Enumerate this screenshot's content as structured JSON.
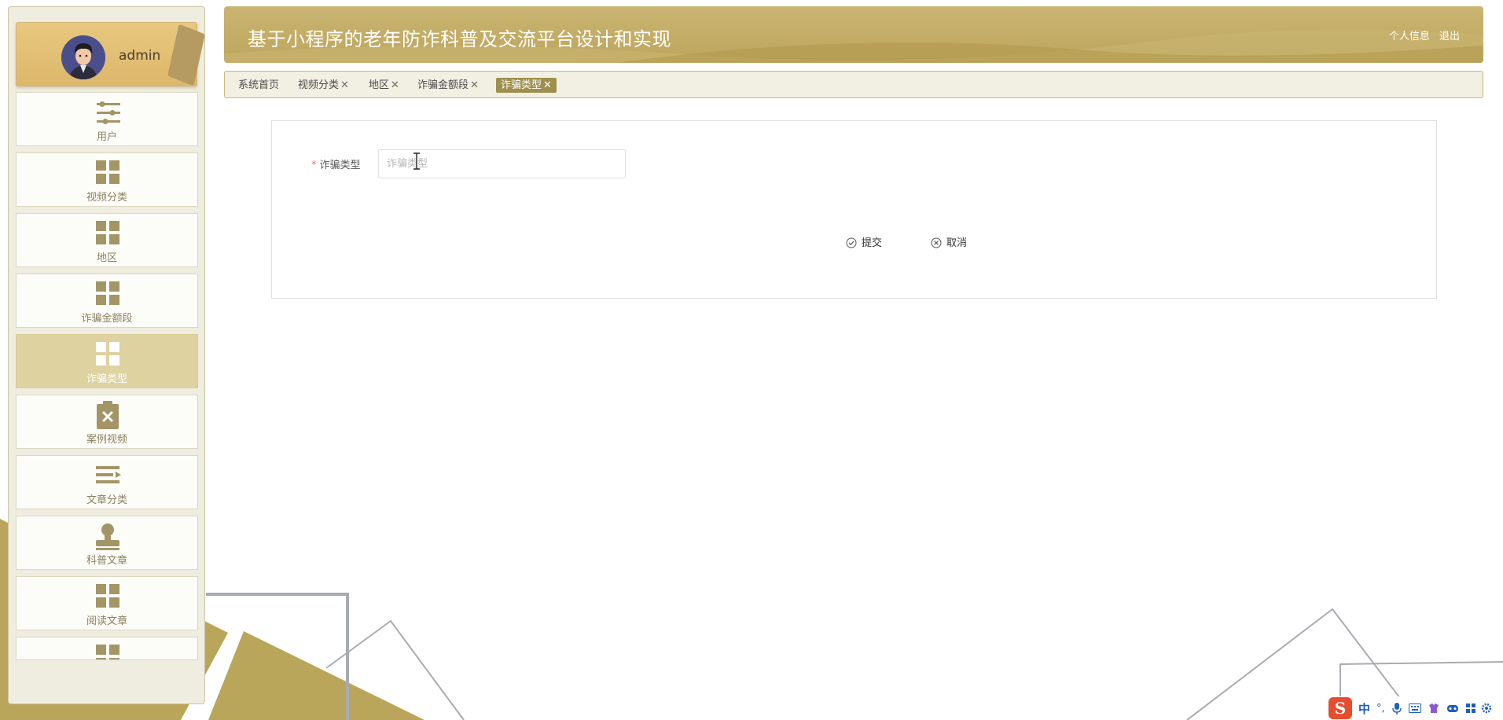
{
  "sidebar": {
    "username": "admin",
    "items": [
      {
        "label": "用户",
        "icon": "sliders-icon",
        "active": false
      },
      {
        "label": "视频分类",
        "icon": "grid-icon",
        "active": false
      },
      {
        "label": "地区",
        "icon": "grid-icon",
        "active": false
      },
      {
        "label": "诈骗金额段",
        "icon": "grid-icon",
        "active": false
      },
      {
        "label": "诈骗类型",
        "icon": "grid-icon",
        "active": true
      },
      {
        "label": "案例视频",
        "icon": "clipboard-x-icon",
        "active": false
      },
      {
        "label": "文章分类",
        "icon": "list-indent-icon",
        "active": false
      },
      {
        "label": "科普文章",
        "icon": "stamp-icon",
        "active": false
      },
      {
        "label": "阅读文章",
        "icon": "grid-icon",
        "active": false
      }
    ]
  },
  "header": {
    "title": "基于小程序的老年防诈科普及交流平台设计和实现",
    "profile_link": "个人信息",
    "logout_link": "退出"
  },
  "tabs": [
    {
      "label": "系统首页",
      "closable": false,
      "active": false
    },
    {
      "label": "视频分类",
      "closable": true,
      "active": false
    },
    {
      "label": "地区",
      "closable": true,
      "active": false
    },
    {
      "label": "诈骗金额段",
      "closable": true,
      "active": false
    },
    {
      "label": "诈骗类型",
      "closable": true,
      "active": true
    }
  ],
  "form": {
    "field_required_mark": "*",
    "field_label": "诈骗类型",
    "field_placeholder": "诈骗类型",
    "field_value": "",
    "submit_label": "提交",
    "cancel_label": "取消"
  },
  "tray": {
    "ime_logo": "S",
    "ime_mode": "中",
    "punct": "°,"
  },
  "colors": {
    "accent": "#bda55c",
    "active_tab": "#9e8f4d",
    "active_menu": "#ddd2a0",
    "required": "#f56c6c"
  }
}
